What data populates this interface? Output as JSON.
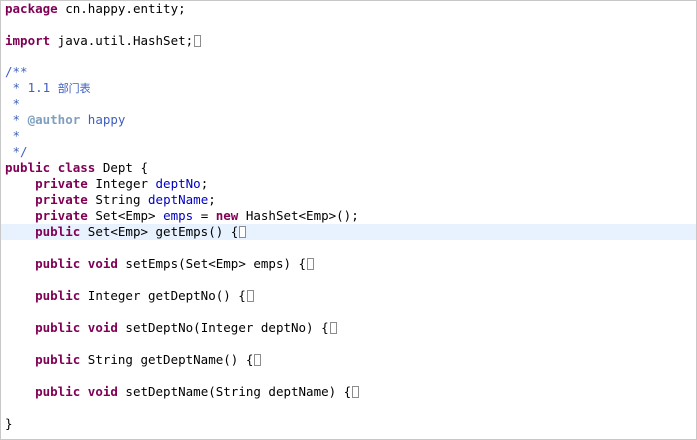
{
  "editor": {
    "line_package": {
      "kw": "package",
      "rest": " cn.happy.entity;"
    },
    "line_import": {
      "kw": "import",
      "rest": " java.util.HashSet;"
    },
    "comment": {
      "open": "/**",
      "line1_prefix": " * 1.1 ",
      "line1_cn": "部门表",
      "star1": " *",
      "author_prefix": " * ",
      "author_tag": "@author",
      "author_name": " happy",
      "star2": " *",
      "close": " */"
    },
    "class_decl": {
      "kw1": "public",
      "sp1": " ",
      "kw2": "class",
      "rest": " Dept {"
    },
    "fields": [
      {
        "indent": "    ",
        "kw": "private",
        "type": " Integer ",
        "name": "deptNo",
        "end": ";"
      },
      {
        "indent": "    ",
        "kw": "private",
        "type": " String ",
        "name": "deptName",
        "end": ";"
      },
      {
        "indent": "    ",
        "kw": "private",
        "type": " Set<Emp> ",
        "name": "emps",
        "mid": " = ",
        "kw2": "new",
        "end": " HashSet<Emp>();"
      }
    ],
    "methods": [
      {
        "indent": "    ",
        "kw": "public",
        "rest": " Set<Emp> getEmps() {"
      },
      {
        "indent": "    ",
        "kw": "public",
        "kw2": " void",
        "rest": " setEmps(Set<Emp> emps) {"
      },
      {
        "indent": "    ",
        "kw": "public",
        "rest": " Integer getDeptNo() {"
      },
      {
        "indent": "    ",
        "kw": "public",
        "kw2": " void",
        "rest": " setDeptNo(Integer deptNo) {"
      },
      {
        "indent": "    ",
        "kw": "public",
        "rest": " String getDeptName() {"
      },
      {
        "indent": "    ",
        "kw": "public",
        "kw2": " void",
        "rest": " setDeptName(String deptName) {"
      }
    ],
    "closing": "}"
  }
}
